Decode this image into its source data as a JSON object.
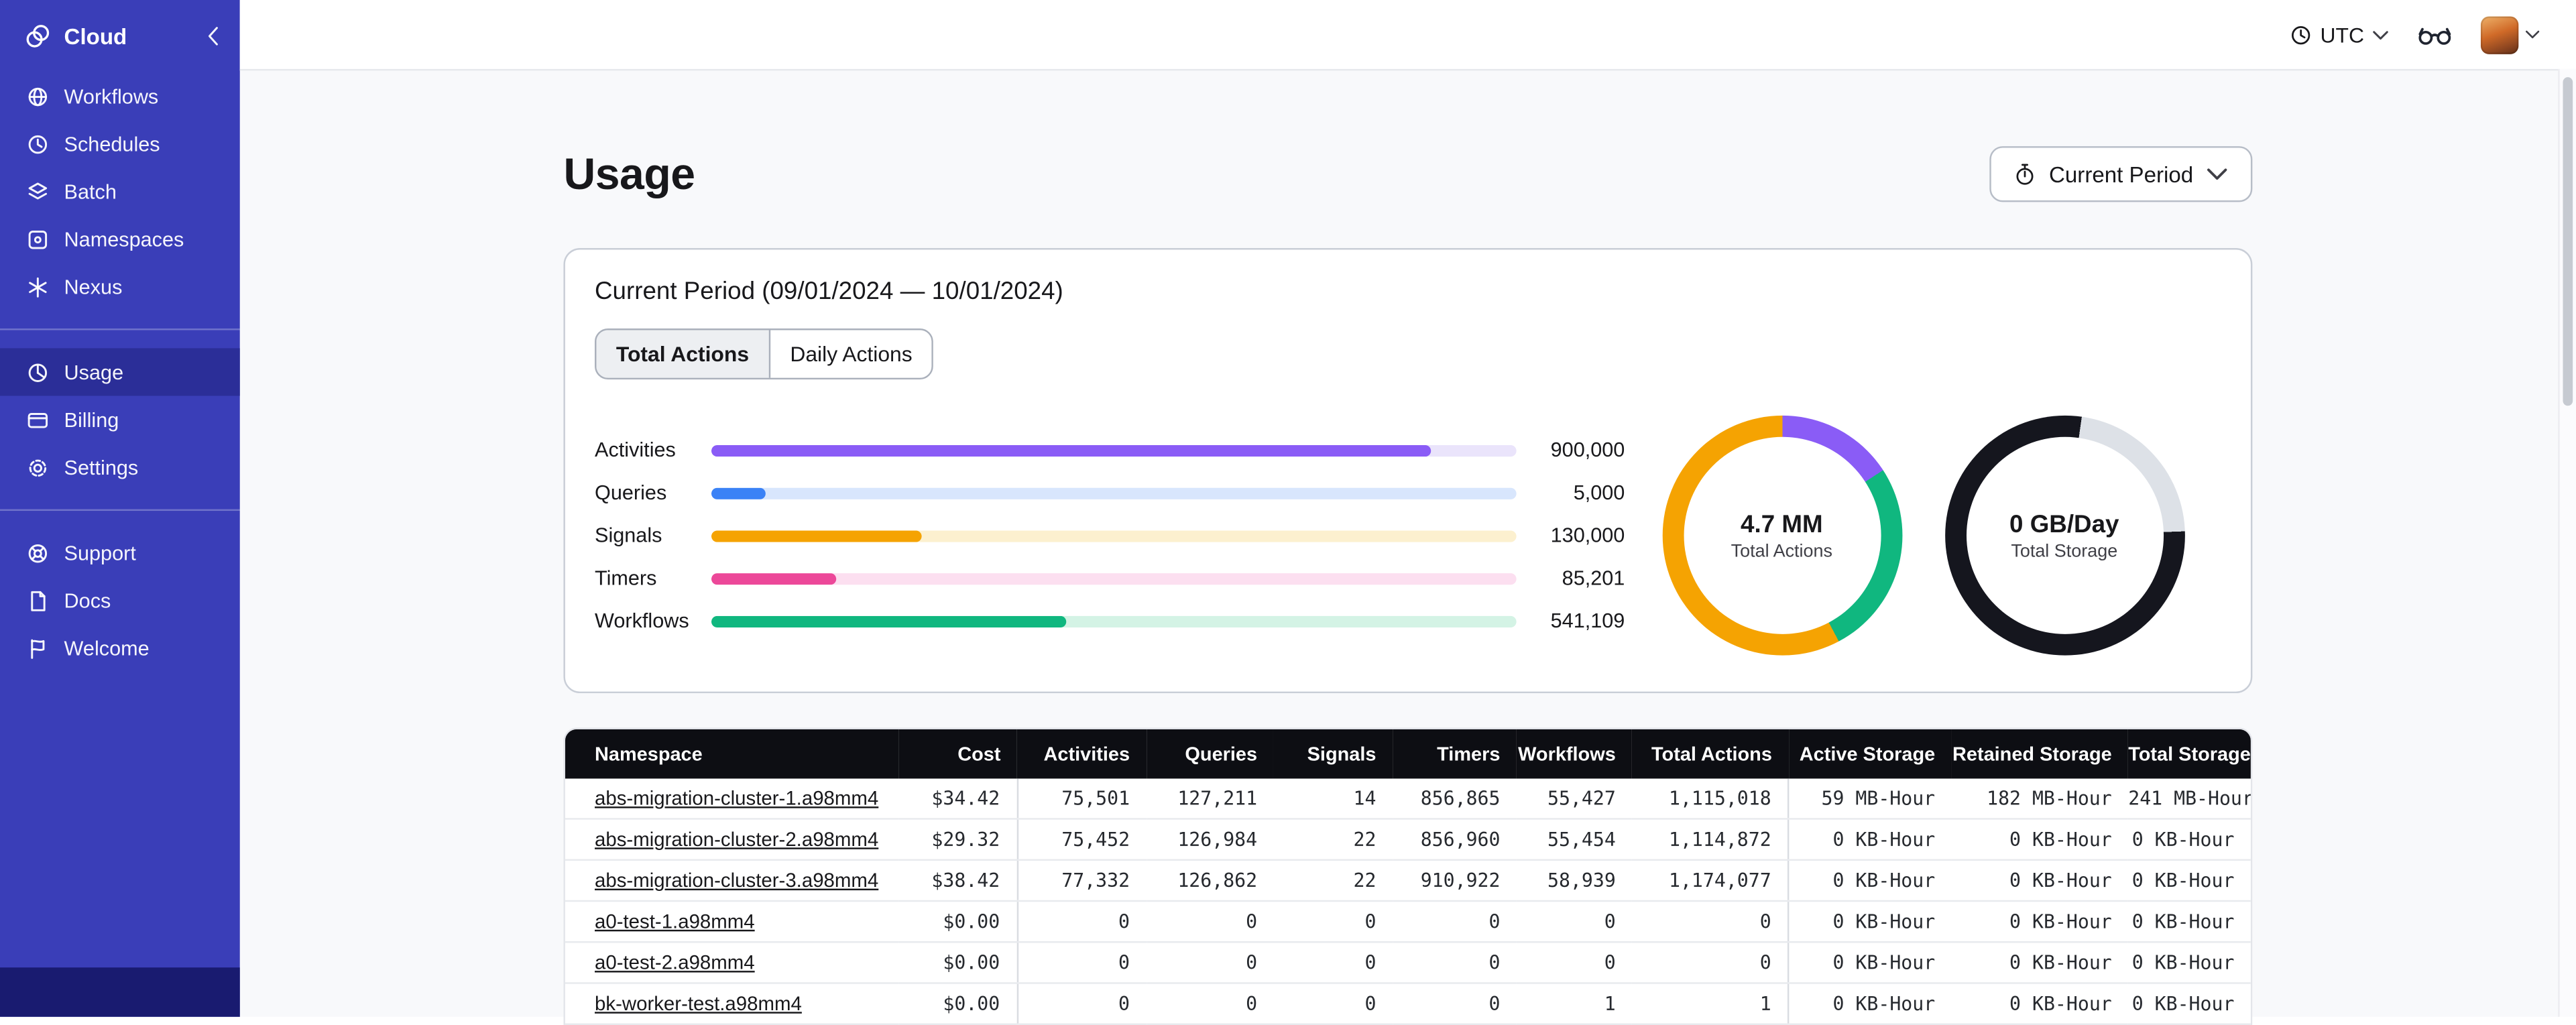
{
  "sidebar": {
    "brand": "Cloud",
    "groups": [
      {
        "items": [
          {
            "label": "Workflows",
            "icon": "workflows-icon"
          },
          {
            "label": "Schedules",
            "icon": "schedules-icon"
          },
          {
            "label": "Batch",
            "icon": "batch-icon"
          },
          {
            "label": "Namespaces",
            "icon": "namespaces-icon"
          },
          {
            "label": "Nexus",
            "icon": "nexus-icon"
          }
        ]
      },
      {
        "items": [
          {
            "label": "Usage",
            "icon": "usage-icon",
            "active": true
          },
          {
            "label": "Billing",
            "icon": "billing-icon"
          },
          {
            "label": "Settings",
            "icon": "settings-icon"
          }
        ]
      },
      {
        "items": [
          {
            "label": "Support",
            "icon": "support-icon"
          },
          {
            "label": "Docs",
            "icon": "docs-icon"
          },
          {
            "label": "Welcome",
            "icon": "welcome-icon"
          }
        ]
      }
    ]
  },
  "topbar": {
    "timezone": "UTC"
  },
  "page": {
    "title": "Usage",
    "period_button_label": "Current Period"
  },
  "usage_card": {
    "title": "Current Period (09/01/2024 — 10/01/2024)",
    "tabs": [
      {
        "label": "Total Actions",
        "active": true
      },
      {
        "label": "Daily Actions",
        "active": false
      }
    ],
    "bars": [
      {
        "label": "Activities",
        "value": "900,000",
        "percent": 89.4,
        "color": "#8a5cf6",
        "track_color": "#eae4fb"
      },
      {
        "label": "Queries",
        "value": "5,000",
        "percent": 6.7,
        "color": "#3b82f6",
        "track_color": "#d8e6fd"
      },
      {
        "label": "Signals",
        "value": "130,000",
        "percent": 26.1,
        "color": "#f5a302",
        "track_color": "#fcf0cf"
      },
      {
        "label": "Timers",
        "value": "85,201",
        "percent": 15.5,
        "color": "#ec4899",
        "track_color": "#fcdff0"
      },
      {
        "label": "Workflows",
        "value": "541,109",
        "percent": 44.1,
        "color": "#10b77f",
        "track_color": "#d4f3e5"
      }
    ],
    "donuts": [
      {
        "value": "4.7 MM",
        "label": "Total Actions",
        "segments": [
          {
            "color": "#8a5cf6",
            "from": 0,
            "to": 57
          },
          {
            "color": "#10b77f",
            "from": 57,
            "to": 152
          },
          {
            "color": "#f5a302",
            "from": 152,
            "to": 360
          }
        ]
      },
      {
        "value": "0 GB/Day",
        "label": "Total Storage",
        "segments": [
          {
            "color": "#15161e",
            "from": 0,
            "to": 8
          },
          {
            "color": "#dde1e7",
            "from": 8,
            "to": 88
          },
          {
            "color": "#15161e",
            "from": 88,
            "to": 360
          }
        ]
      }
    ]
  },
  "table": {
    "columns": [
      "Namespace",
      "Cost",
      "Activities",
      "Queries",
      "Signals",
      "Timers",
      "Workflows",
      "Total Actions",
      "Active Storage",
      "Retained Storage",
      "Total Storage"
    ],
    "rows": [
      [
        "abs-migration-cluster-1.a98mm4",
        "$34.42",
        "75,501",
        "127,211",
        "14",
        "856,865",
        "55,427",
        "1,115,018",
        "59 MB-Hour",
        "182 MB-Hour",
        "241 MB-Hour"
      ],
      [
        "abs-migration-cluster-2.a98mm4",
        "$29.32",
        "75,452",
        "126,984",
        "22",
        "856,960",
        "55,454",
        "1,114,872",
        "0 KB-Hour",
        "0 KB-Hour",
        "0 KB-Hour"
      ],
      [
        "abs-migration-cluster-3.a98mm4",
        "$38.42",
        "77,332",
        "126,862",
        "22",
        "910,922",
        "58,939",
        "1,174,077",
        "0 KB-Hour",
        "0 KB-Hour",
        "0 KB-Hour"
      ],
      [
        "a0-test-1.a98mm4",
        "$0.00",
        "0",
        "0",
        "0",
        "0",
        "0",
        "0",
        "0 KB-Hour",
        "0 KB-Hour",
        "0 KB-Hour"
      ],
      [
        "a0-test-2.a98mm4",
        "$0.00",
        "0",
        "0",
        "0",
        "0",
        "0",
        "0",
        "0 KB-Hour",
        "0 KB-Hour",
        "0 KB-Hour"
      ],
      [
        "bk-worker-test.a98mm4",
        "$0.00",
        "0",
        "0",
        "0",
        "0",
        "1",
        "1",
        "0 KB-Hour",
        "0 KB-Hour",
        "0 KB-Hour"
      ]
    ]
  }
}
